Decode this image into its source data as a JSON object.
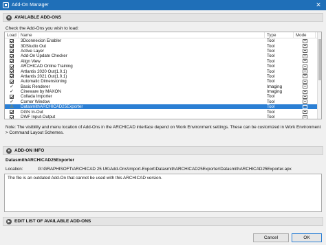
{
  "window": {
    "title": "Add-On Manager"
  },
  "available": {
    "header": "AVAILABLE ADD-ONS",
    "instruction": "Check the Add-Ons you wish to load:",
    "columns": {
      "load": "Load",
      "name": "Name",
      "type": "Type",
      "mode": "Mode"
    },
    "rows": [
      {
        "name": "3Dconnexion Enabler",
        "type": "Tool",
        "load": "checked"
      },
      {
        "name": "3DStudio Out",
        "type": "Tool",
        "load": "checked"
      },
      {
        "name": "Active Layer",
        "type": "Tool",
        "load": "checked"
      },
      {
        "name": "Add-On Update Checker",
        "type": "Tool",
        "load": "checked"
      },
      {
        "name": "Align View",
        "type": "Tool",
        "load": "checked"
      },
      {
        "name": "ARCHICAD Online Training",
        "type": "Tool",
        "load": "checked"
      },
      {
        "name": "Artlantis 2020 Out(1.0.1)",
        "type": "Tool",
        "load": "checked"
      },
      {
        "name": "Artlantis 2021 Out(1.0.1)",
        "type": "Tool",
        "load": "checked"
      },
      {
        "name": "Automatic Dimensioning",
        "type": "Tool",
        "load": "checked"
      },
      {
        "name": "Basic Renderer",
        "type": "Imaging",
        "load": "tick"
      },
      {
        "name": "Cineware by MAXON",
        "type": "Imaging",
        "load": "tick"
      },
      {
        "name": "Collada Importer",
        "type": "Tool",
        "load": "checked"
      },
      {
        "name": "Corner Window",
        "type": "Tool",
        "load": "tick"
      },
      {
        "name": "DatasmithARCHICAD25Exporter",
        "type": "Tool",
        "load": "warning",
        "selected": true
      },
      {
        "name": "DGN In-Out",
        "type": "Tool",
        "load": "checked"
      },
      {
        "name": "DWF Input-Output",
        "type": "Tool",
        "load": "checked"
      }
    ]
  },
  "note": "Note: The visibility and menu location of Add-Ons in the ARCHICAD interface depend on Work Environment settings. These can be customized in Work Environment > Command Layout Schemes.",
  "info": {
    "header": "ADD-ON INFO",
    "name": "DatasmithARCHICAD25Exporter",
    "location_label": "Location:",
    "location_value": "G:\\GRAPHISOFT\\ARCHICAD 25 UK\\Add-Ons\\Import-Export\\DatasmithARCHICAD25Exporter\\DatasmithARCHICAD25Exporter.apx",
    "message": "The file is an outdated Add-On that cannot be used with this ARCHICAD version."
  },
  "edit_list": {
    "header": "EDIT LIST OF AVAILABLE ADD-ONS"
  },
  "buttons": {
    "cancel": "Cancel",
    "ok": "OK"
  }
}
